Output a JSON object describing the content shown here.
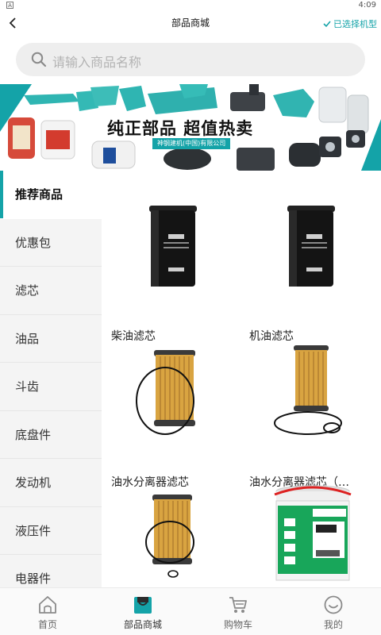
{
  "status_bar": {
    "time": "4:09",
    "sim_icon": "sim-card-icon"
  },
  "header": {
    "title": "部品商城",
    "back_icon": "chevron-left-icon",
    "model_label": "已选择机型",
    "model_icon": "check-icon"
  },
  "search": {
    "placeholder": "请输入商品名称",
    "icon": "search-icon"
  },
  "banner": {
    "slogan": "纯正部品  超值热卖",
    "company": "神钢建机(中国)有限公司"
  },
  "categories": [
    {
      "label": "推荐商品",
      "active": true
    },
    {
      "label": "优惠包",
      "active": false
    },
    {
      "label": "滤芯",
      "active": false
    },
    {
      "label": "油品",
      "active": false
    },
    {
      "label": "斗齿",
      "active": false
    },
    {
      "label": "底盘件",
      "active": false
    },
    {
      "label": "发动机",
      "active": false
    },
    {
      "label": "液压件",
      "active": false
    },
    {
      "label": "电器件",
      "active": false
    }
  ],
  "products": [
    {
      "name": "柴油滤芯",
      "image": "black-spin-on-filter"
    },
    {
      "name": "机油滤芯",
      "image": "black-spin-on-filter"
    },
    {
      "name": "油水分离器滤芯",
      "image": "pleated-filter-with-o-ring"
    },
    {
      "name": "油水分离器滤芯（…",
      "image": "pleated-filter-with-o-rings"
    },
    {
      "name": "",
      "image": "pleated-filter-with-o-ring"
    },
    {
      "name": "",
      "image": "oil-bucket"
    }
  ],
  "tabbar": [
    {
      "label": "首页",
      "icon": "home-icon",
      "active": false
    },
    {
      "label": "部品商城",
      "icon": "mall-icon",
      "active": true
    },
    {
      "label": "购物车",
      "icon": "cart-icon",
      "active": false
    },
    {
      "label": "我的",
      "icon": "profile-icon",
      "active": false
    }
  ],
  "colors": {
    "accent": "#14a3a8",
    "sidebar_bg": "#f4f4f4",
    "search_bg": "#eeeeee"
  }
}
